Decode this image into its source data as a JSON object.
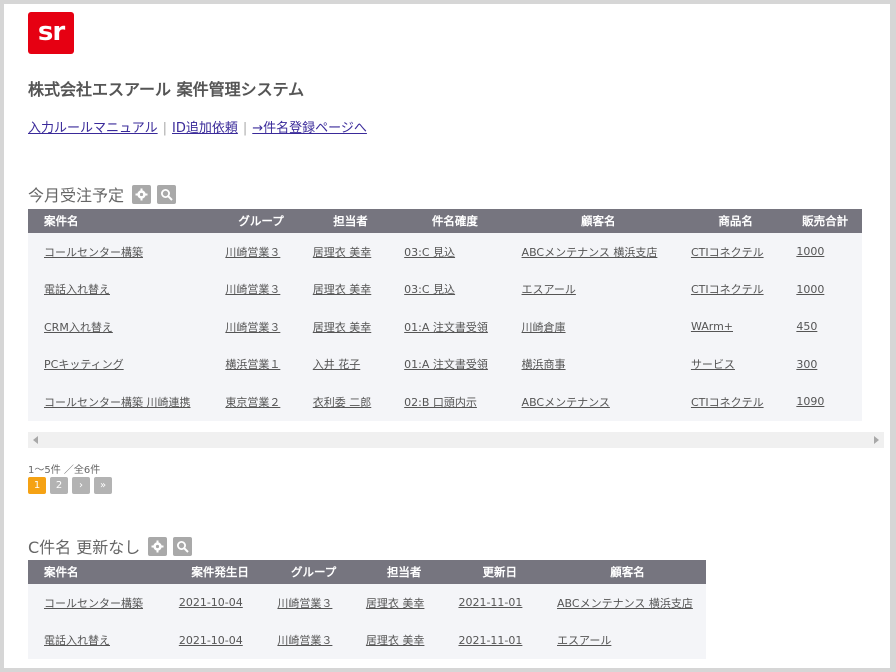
{
  "header": {
    "logo_text": "sr",
    "title": "株式会社エスアール 案件管理システム"
  },
  "nav": {
    "manual": "入力ルールマニュアル",
    "sep": "|",
    "id_request": "ID追加依頼",
    "register": "→件名登録ページへ"
  },
  "section1": {
    "title": "今月受注予定",
    "icons": [
      "gear-icon",
      "search-icon"
    ],
    "columns": [
      "案件名",
      "グループ",
      "担当者",
      "件名確度",
      "顧客名",
      "商品名",
      "販売合計"
    ],
    "rows": [
      [
        "コールセンター構築",
        "川崎営業３",
        "居理衣 美幸",
        "03:C 見込",
        "ABCメンテナンス 横浜支店",
        "CTIコネクテル",
        "1000"
      ],
      [
        "電話入れ替え",
        "川崎営業３",
        "居理衣 美幸",
        "03:C 見込",
        "エスアール",
        "CTIコネクテル",
        "1000"
      ],
      [
        "CRM入れ替え",
        "川崎営業３",
        "居理衣 美幸",
        "01:A 注文書受領",
        "川崎倉庫",
        "WArm+",
        "450"
      ],
      [
        "PCキッティング",
        "横浜営業１",
        "入井 花子",
        "01:A 注文書受領",
        "横浜商事",
        "サービス",
        "300"
      ],
      [
        "コールセンター構築 川崎連携",
        "東京営業２",
        "衣利委 二郎",
        "02:B 口頭内示",
        "ABCメンテナンス",
        "CTIコネクテル",
        "1090"
      ]
    ],
    "pager_info": "1～5件 ／全6件",
    "pages": [
      "1",
      "2",
      "›",
      "»"
    ]
  },
  "section2": {
    "title": "C件名 更新なし",
    "icons": [
      "gear-icon",
      "search-icon"
    ],
    "columns": [
      "案件名",
      "案件発生日",
      "グループ",
      "担当者",
      "更新日",
      "顧客名"
    ],
    "rows": [
      [
        "コールセンター構築",
        "2021-10-04",
        "川崎営業３",
        "居理衣 美幸",
        "2021-11-01",
        "ABCメンテナンス 横浜支店"
      ],
      [
        "電話入れ替え",
        "2021-10-04",
        "川崎営業３",
        "居理衣 美幸",
        "2021-11-01",
        "エスアール"
      ]
    ]
  },
  "colors": {
    "logo": "#e60012",
    "header_bg": "#76757f",
    "row_bg": "#f4f5f8",
    "active_page": "#f5a214",
    "link": "#3a2a9a"
  }
}
